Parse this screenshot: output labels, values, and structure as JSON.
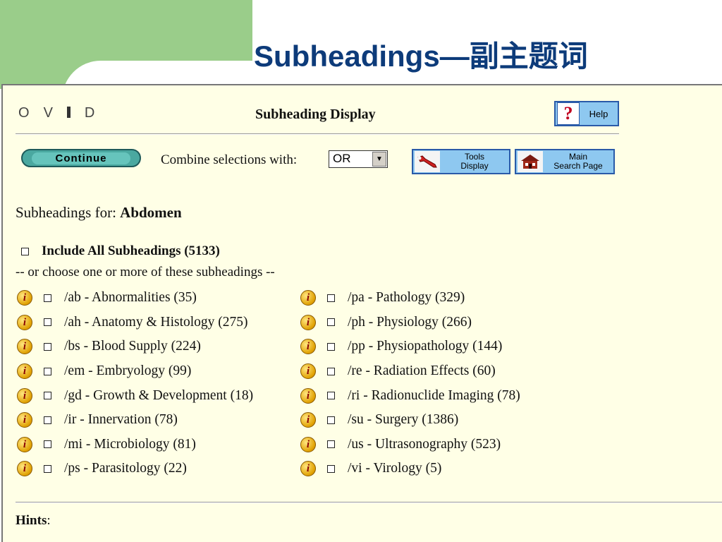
{
  "slide": {
    "title": "Subheadings—副主题词"
  },
  "header": {
    "logo_letters": [
      "O",
      "V",
      "D"
    ],
    "title": "Subheading Display",
    "help_label": "Help",
    "help_icon": "?"
  },
  "toolbar": {
    "continue_label": "Continue",
    "combine_label": "Combine selections with:",
    "combine_value": "OR",
    "tools_label_1": "Tools",
    "tools_label_2": "Display",
    "main_label_1": "Main",
    "main_label_2": "Search Page"
  },
  "subheadings": {
    "for_label": "Subheadings for:",
    "term": "Abdomen",
    "include_all": "Include All Subheadings (5133)",
    "choose_text": "-- or choose one or more of these subheadings --",
    "left": [
      "/ab - Abnormalities (35)",
      "/ah - Anatomy & Histology (275)",
      "/bs - Blood Supply (224)",
      "/em - Embryology (99)",
      "/gd - Growth & Development (18)",
      "/ir - Innervation (78)",
      "/mi - Microbiology (81)",
      "/ps - Parasitology (22)"
    ],
    "right": [
      "/pa - Pathology (329)",
      "/ph - Physiology (266)",
      "/pp - Physiopathology (144)",
      "/re - Radiation Effects (60)",
      "/ri - Radionuclide Imaging (78)",
      "/su - Surgery (1386)",
      "/us - Ultrasonography (523)",
      "/vi - Virology (5)"
    ]
  },
  "footer": {
    "hints_label": "Hints",
    "hints_colon": ":"
  },
  "colors": {
    "title": "#0d3b7a",
    "background": "#ffffe6",
    "button": "#8ec8f0",
    "accent_green": "#9acd8a"
  }
}
